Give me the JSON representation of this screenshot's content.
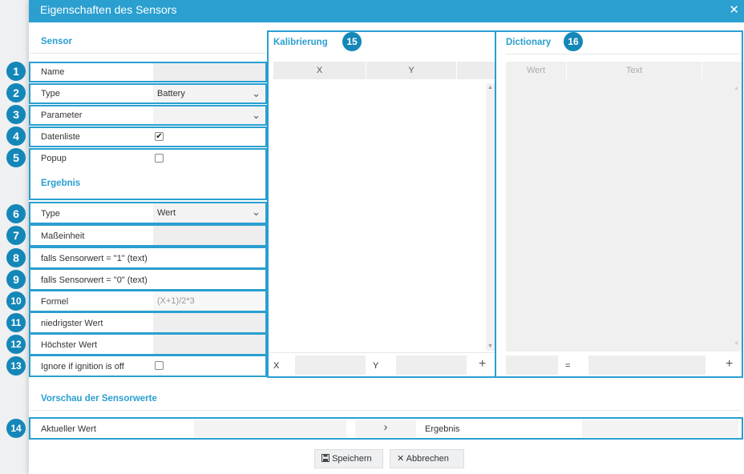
{
  "dialog": {
    "title": "Eigenschaften des Sensors",
    "close_icon": "✕"
  },
  "sensor": {
    "heading": "Sensor",
    "name_label": "Name",
    "type_label": "Type",
    "type_value": "Battery",
    "parameter_label": "Parameter",
    "parameter_value": "",
    "datenliste_label": "Datenliste",
    "datenliste_checked": true,
    "popup_label": "Popup",
    "popup_checked": false
  },
  "ergebnis": {
    "heading": "Ergebnis",
    "type_label": "Type",
    "type_value": "Wert",
    "masseinheit_label": "Maßeinheit",
    "text1_label": "falls Sensorwert = \"1\" (text)",
    "text0_label": "falls Sensorwert = \"0\" (text)",
    "formel_label": "Formel",
    "formel_placeholder": "(X+1)/2*3",
    "min_label": "niedrigster Wert",
    "max_label": "Höchster Wert",
    "ignore_label": "Ignore if ignition is off",
    "ignore_checked": false
  },
  "kalibrierung": {
    "heading": "Kalibrierung",
    "col_x": "X",
    "col_y": "Y",
    "input_x_label": "X",
    "input_y_label": "Y",
    "add_icon": "+"
  },
  "dictionary": {
    "heading": "Dictionary",
    "col_wert": "Wert",
    "col_text": "Text",
    "equals": "=",
    "add_icon": "+"
  },
  "vorschau": {
    "heading": "Vorschau der Sensorwerte",
    "aktueller_label": "Aktueller Wert",
    "arrow_icon": "›",
    "ergebnis_label": "Ergebnis"
  },
  "buttons": {
    "save_label": "Speichern",
    "save_icon": "floppy-icon",
    "cancel_label": "Abbrechen",
    "cancel_icon": "x-icon"
  },
  "callouts": [
    "1",
    "2",
    "3",
    "4",
    "5",
    "6",
    "7",
    "8",
    "9",
    "10",
    "11",
    "12",
    "13",
    "14",
    "15",
    "16"
  ],
  "colors": {
    "accent": "#2a9fd0",
    "badge": "#1487b8"
  }
}
